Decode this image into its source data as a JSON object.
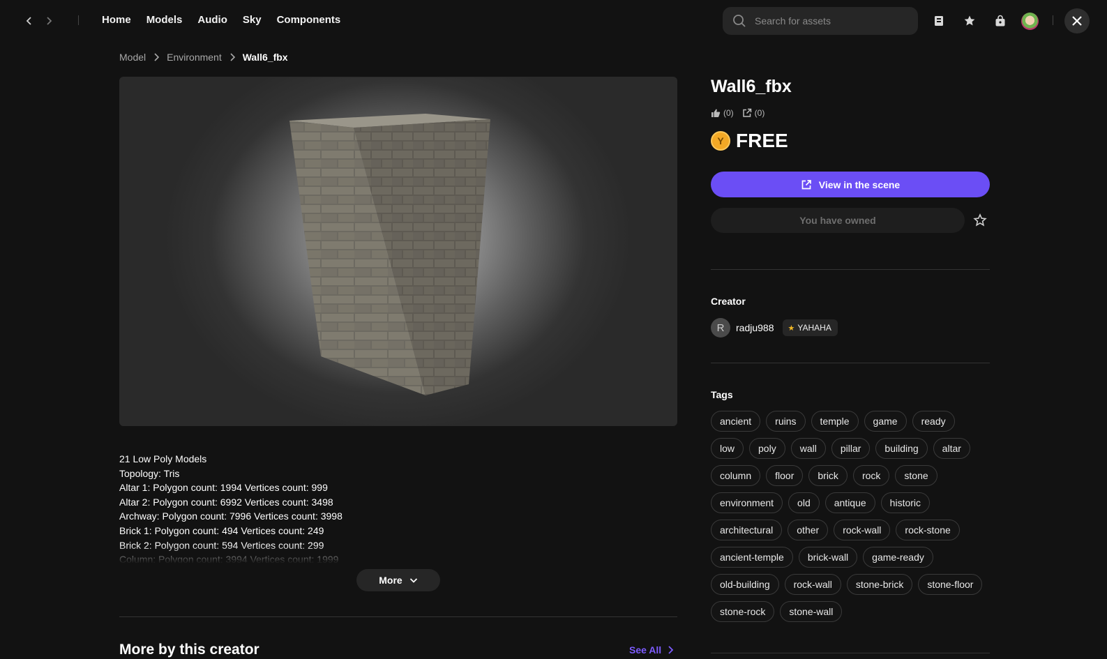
{
  "nav": {
    "back_icon": "chevron-left-icon",
    "forward_icon": "chevron-right-icon",
    "menu": [
      "Home",
      "Models",
      "Audio",
      "Sky",
      "Components"
    ]
  },
  "search": {
    "placeholder": "Search for assets"
  },
  "breadcrumb": [
    "Model",
    "Environment",
    "Wall6_fbx"
  ],
  "asset": {
    "title": "Wall6_fbx",
    "likes": "(0)",
    "shares": "(0)",
    "price": "FREE",
    "coin_symbol": "Y",
    "view_button": "View in the scene",
    "owned_button": "You have owned"
  },
  "description": [
    "21 Low Poly Models",
    "Topology: Tris",
    "Altar 1: Polygon count: 1994 Vertices count: 999",
    "Altar 2: Polygon count: 6992 Vertices count: 3498",
    "Archway: Polygon count: 7996 Vertices count: 3998",
    "Brick 1: Polygon count: 494 Vertices count: 249",
    "Brick 2: Polygon count: 594 Vertices count: 299",
    "Column: Polygon count: 3994 Vertices count: 1999"
  ],
  "more_button": "More",
  "more_by_creator": {
    "heading": "More by this creator",
    "see_all": "See All"
  },
  "creator": {
    "heading": "Creator",
    "initial": "R",
    "name": "radju988",
    "badge": "YAHAHA"
  },
  "tags_heading": "Tags",
  "tags": [
    "ancient",
    "ruins",
    "temple",
    "game",
    "ready",
    "low",
    "poly",
    "wall",
    "pillar",
    "building",
    "altar",
    "column",
    "floor",
    "brick",
    "rock",
    "stone",
    "environment",
    "old",
    "antique",
    "historic",
    "architectural",
    "other",
    "rock-wall",
    "rock-stone",
    "ancient-temple",
    "brick-wall",
    "game-ready",
    "old-building",
    "rock-wall",
    "stone-brick",
    "stone-floor",
    "stone-rock",
    "stone-wall"
  ],
  "colors": {
    "accent": "#6b4ef5",
    "link": "#7d5cff",
    "coin": "#f3a926",
    "background": "#121212"
  }
}
